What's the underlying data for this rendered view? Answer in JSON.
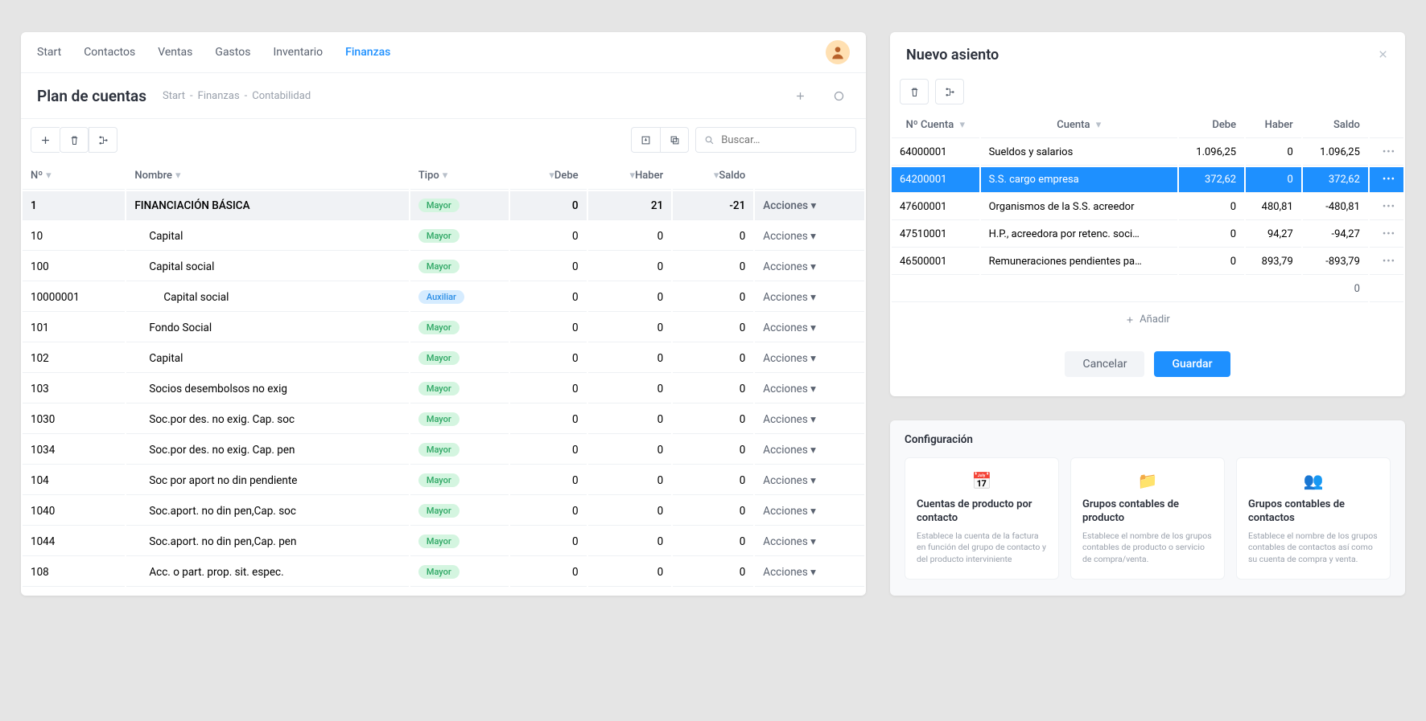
{
  "nav": {
    "items": [
      "Start",
      "Contactos",
      "Ventas",
      "Gastos",
      "Inventario",
      "Finanzas"
    ],
    "activeIndex": 5
  },
  "page": {
    "title": "Plan de cuentas",
    "breadcrumb": [
      "Start",
      "Finanzas",
      "Contabilidad"
    ]
  },
  "search": {
    "placeholder": "Buscar…"
  },
  "columns": {
    "no": "Nº",
    "nombre": "Nombre",
    "tipo": "Tipo",
    "debe": "Debe",
    "haber": "Haber",
    "saldo": "Saldo",
    "acciones": "Acciones"
  },
  "rows": [
    {
      "no": "1",
      "nombre": "FINANCIACIÓN BÁSICA",
      "tipo": "Mayor",
      "debe": "0",
      "haber": "21",
      "saldo": "-21",
      "selected": true,
      "indent": 0
    },
    {
      "no": "10",
      "nombre": "Capital",
      "tipo": "Mayor",
      "debe": "0",
      "haber": "0",
      "saldo": "0",
      "indent": 1
    },
    {
      "no": "100",
      "nombre": "Capital social",
      "tipo": "Mayor",
      "debe": "0",
      "haber": "0",
      "saldo": "0",
      "indent": 1
    },
    {
      "no": "10000001",
      "nombre": "Capital social",
      "tipo": "Auxiliar",
      "debe": "0",
      "haber": "0",
      "saldo": "0",
      "indent": 2
    },
    {
      "no": "101",
      "nombre": "Fondo Social",
      "tipo": "Mayor",
      "debe": "0",
      "haber": "0",
      "saldo": "0",
      "indent": 1
    },
    {
      "no": "102",
      "nombre": "Capital",
      "tipo": "Mayor",
      "debe": "0",
      "haber": "0",
      "saldo": "0",
      "indent": 1
    },
    {
      "no": "103",
      "nombre": "Socios desembolsos no exig",
      "tipo": "Mayor",
      "debe": "0",
      "haber": "0",
      "saldo": "0",
      "indent": 1
    },
    {
      "no": "1030",
      "nombre": "Soc.por des. no exig. Cap. soc",
      "tipo": "Mayor",
      "debe": "0",
      "haber": "0",
      "saldo": "0",
      "indent": 1
    },
    {
      "no": "1034",
      "nombre": "Soc.por des. no exig. Cap. pen",
      "tipo": "Mayor",
      "debe": "0",
      "haber": "0",
      "saldo": "0",
      "indent": 1
    },
    {
      "no": "104",
      "nombre": "Soc por aport no din pendiente",
      "tipo": "Mayor",
      "debe": "0",
      "haber": "0",
      "saldo": "0",
      "indent": 1
    },
    {
      "no": "1040",
      "nombre": "Soc.aport. no din pen,Cap. soc",
      "tipo": "Mayor",
      "debe": "0",
      "haber": "0",
      "saldo": "0",
      "indent": 1
    },
    {
      "no": "1044",
      "nombre": "Soc.aport. no din pen,Cap. pen",
      "tipo": "Mayor",
      "debe": "0",
      "haber": "0",
      "saldo": "0",
      "indent": 1
    },
    {
      "no": "108",
      "nombre": "Acc. o part. prop. sit. espec.",
      "tipo": "Mayor",
      "debe": "0",
      "haber": "0",
      "saldo": "0",
      "indent": 1
    }
  ],
  "modal": {
    "title": "Nuevo asiento",
    "columns": {
      "no": "Nº Cuenta",
      "cuenta": "Cuenta",
      "debe": "Debe",
      "haber": "Haber",
      "saldo": "Saldo"
    },
    "rows": [
      {
        "no": "64000001",
        "cuenta": "Sueldos y salarios",
        "debe": "1.096,25",
        "haber": "0",
        "saldo": "1.096,25"
      },
      {
        "no": "64200001",
        "cuenta": "S.S. cargo empresa",
        "debe": "372,62",
        "haber": "0",
        "saldo": "372,62",
        "hl": true
      },
      {
        "no": "47600001",
        "cuenta": "Organismos de la S.S. acreedor",
        "debe": "0",
        "haber": "480,81",
        "saldo": "-480,81"
      },
      {
        "no": "47510001",
        "cuenta": "H.P., acreedora por retenc. soci…",
        "debe": "0",
        "haber": "94,27",
        "saldo": "-94,27"
      },
      {
        "no": "46500001",
        "cuenta": "Remuneraciones pendientes pa…",
        "debe": "0",
        "haber": "893,79",
        "saldo": "-893,79"
      }
    ],
    "sum": "0",
    "add": "Añadir",
    "cancel": "Cancelar",
    "save": "Guardar"
  },
  "config": {
    "title": "Configuración",
    "cards": [
      {
        "icon": "📅",
        "title": "Cuentas de producto por contacto",
        "desc": "Establece la cuenta de la factura en función del grupo de contacto y del producto interviniente"
      },
      {
        "icon": "📁",
        "title": "Grupos contables de producto",
        "desc": "Establece el nombre de los grupos contables de producto o servicio de compra/venta."
      },
      {
        "icon": "👥",
        "title": "Grupos contables de contactos",
        "desc": "Establece el nombre de los grupos contables de contactos así como su cuenta de compra y venta."
      }
    ]
  }
}
